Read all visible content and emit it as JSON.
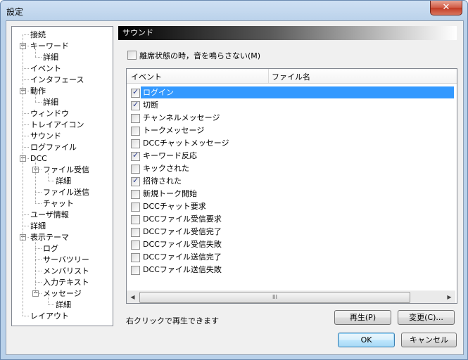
{
  "window": {
    "title": "設定",
    "close_glyph": "✕"
  },
  "tree": [
    {
      "label": "接続",
      "depth": 0,
      "expander": ""
    },
    {
      "label": "キーワード",
      "depth": 0,
      "expander": "−"
    },
    {
      "label": "詳細",
      "depth": 1,
      "expander": ""
    },
    {
      "label": "イベント",
      "depth": 0,
      "expander": ""
    },
    {
      "label": "インタフェース",
      "depth": 0,
      "expander": ""
    },
    {
      "label": "動作",
      "depth": 0,
      "expander": "−"
    },
    {
      "label": "詳細",
      "depth": 1,
      "expander": ""
    },
    {
      "label": "ウィンドウ",
      "depth": 0,
      "expander": ""
    },
    {
      "label": "トレイアイコン",
      "depth": 0,
      "expander": ""
    },
    {
      "label": "サウンド",
      "depth": 0,
      "expander": ""
    },
    {
      "label": "ログファイル",
      "depth": 0,
      "expander": ""
    },
    {
      "label": "DCC",
      "depth": 0,
      "expander": "−"
    },
    {
      "label": "ファイル受信",
      "depth": 1,
      "expander": "−"
    },
    {
      "label": "詳細",
      "depth": 2,
      "expander": ""
    },
    {
      "label": "ファイル送信",
      "depth": 1,
      "expander": ""
    },
    {
      "label": "チャット",
      "depth": 1,
      "expander": ""
    },
    {
      "label": "ユーザ情報",
      "depth": 0,
      "expander": ""
    },
    {
      "label": "詳細",
      "depth": 0,
      "expander": ""
    },
    {
      "label": "表示テーマ",
      "depth": 0,
      "expander": "−"
    },
    {
      "label": "ログ",
      "depth": 1,
      "expander": ""
    },
    {
      "label": "サーバツリー",
      "depth": 1,
      "expander": ""
    },
    {
      "label": "メンバリスト",
      "depth": 1,
      "expander": ""
    },
    {
      "label": "入力テキスト",
      "depth": 1,
      "expander": ""
    },
    {
      "label": "メッセージ",
      "depth": 1,
      "expander": "−"
    },
    {
      "label": "詳細",
      "depth": 2,
      "expander": ""
    },
    {
      "label": "レイアウト",
      "depth": 0,
      "expander": ""
    }
  ],
  "panel": {
    "title": "サウンド",
    "mute_label": "離席状態の時，音を鳴らさない(M)",
    "mute_checked": false
  },
  "list": {
    "columns": [
      "イベント",
      "ファイル名"
    ],
    "rows": [
      {
        "label": "ログイン",
        "checked": true,
        "selected": true
      },
      {
        "label": "切断",
        "checked": true
      },
      {
        "label": "チャンネルメッセージ",
        "checked": false
      },
      {
        "label": "トークメッセージ",
        "checked": false
      },
      {
        "label": "DCCチャットメッセージ",
        "checked": false
      },
      {
        "label": "キーワード反応",
        "checked": true
      },
      {
        "label": "キックされた",
        "checked": false
      },
      {
        "label": "招待された",
        "checked": true
      },
      {
        "label": "新規トーク開始",
        "checked": false
      },
      {
        "label": "DCCチャット要求",
        "checked": false
      },
      {
        "label": "DCCファイル受信要求",
        "checked": false
      },
      {
        "label": "DCCファイル受信完了",
        "checked": false
      },
      {
        "label": "DCCファイル受信失敗",
        "checked": false
      },
      {
        "label": "DCCファイル送信完了",
        "checked": false
      },
      {
        "label": "DCCファイル送信失敗",
        "checked": false
      }
    ],
    "scroll_left": "◀",
    "scroll_right": "▶",
    "scroll_grip": "III"
  },
  "hint": "右クリックで再生できます",
  "buttons": {
    "play": "再生(P)",
    "change": "変更(C)...",
    "ok": "OK",
    "cancel": "キャンセル"
  }
}
